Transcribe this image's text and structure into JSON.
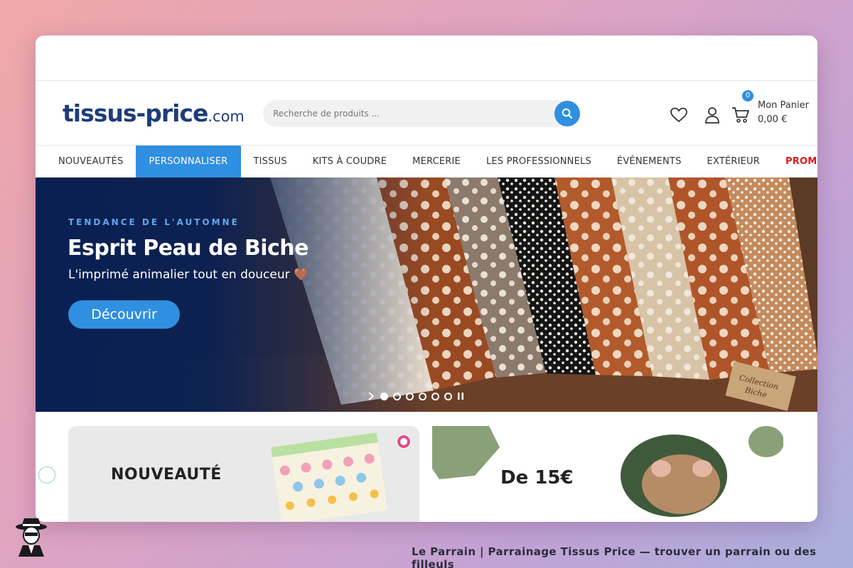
{
  "site": {
    "logo_main": "tissus-price",
    "logo_tld": ".com"
  },
  "search": {
    "placeholder": "Recherche de produits ..."
  },
  "cart": {
    "count": "0",
    "label": "Mon Panier",
    "total": "0,00 €"
  },
  "nav": {
    "items": [
      {
        "label": "NOUVEAUTÉS"
      },
      {
        "label": "PERSONNALISER"
      },
      {
        "label": "TISSUS"
      },
      {
        "label": "KITS À COUDRE"
      },
      {
        "label": "MERCERIE"
      },
      {
        "label": "LES PROFESSIONNELS"
      },
      {
        "label": "ÉVÉNEMENTS"
      },
      {
        "label": "EXTÉRIEUR"
      },
      {
        "label": "PROMOS"
      }
    ]
  },
  "hero": {
    "eyebrow": "TENDANCE DE L'AUTOMNE",
    "title": "Esprit Peau de Biche",
    "subtitle": "L'imprimé animalier tout en douceur 🤎",
    "cta": "Découvrir",
    "slides_total": 6,
    "slide_active": 1
  },
  "cards": {
    "card1_heading": "NOUVEAUTÉ",
    "card2_heading": "De 15€"
  },
  "footer": {
    "credit": "Le Parrain | Parrainage Tissus Price — trouver un parrain ou des filleuls"
  },
  "colors": {
    "accent": "#2f8fe0",
    "brand_navy": "#1d3d7a",
    "promo_red": "#e0161e"
  }
}
